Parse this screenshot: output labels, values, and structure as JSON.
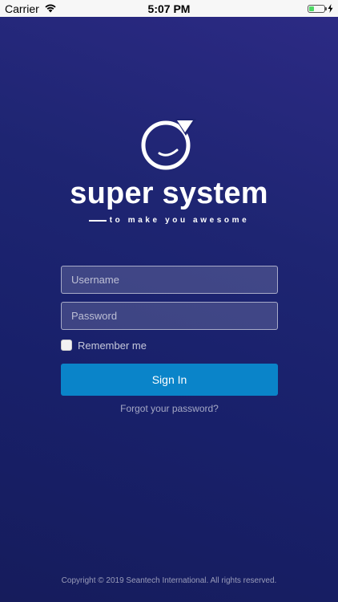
{
  "status_bar": {
    "carrier": "Carrier",
    "time": "5:07 PM",
    "battery_level": 0.35,
    "wifi_icon": "wifi-icon",
    "charging_icon": "lightning-icon"
  },
  "logo": {
    "name": "super system",
    "tagline": "to make you awesome"
  },
  "form": {
    "username_placeholder": "Username",
    "password_placeholder": "Password",
    "remember_label": "Remember me",
    "remember_checked": false,
    "signin_label": "Sign In",
    "forgot_label": "Forgot your password?"
  },
  "footer": {
    "copyright": "Copyright © 2019 Seantech International. All rights reserved."
  },
  "colors": {
    "background_top": "#2c2a84",
    "background_bottom": "#161c5c",
    "signin_button": "#0a84c9",
    "battery_fill": "#4cd964"
  }
}
